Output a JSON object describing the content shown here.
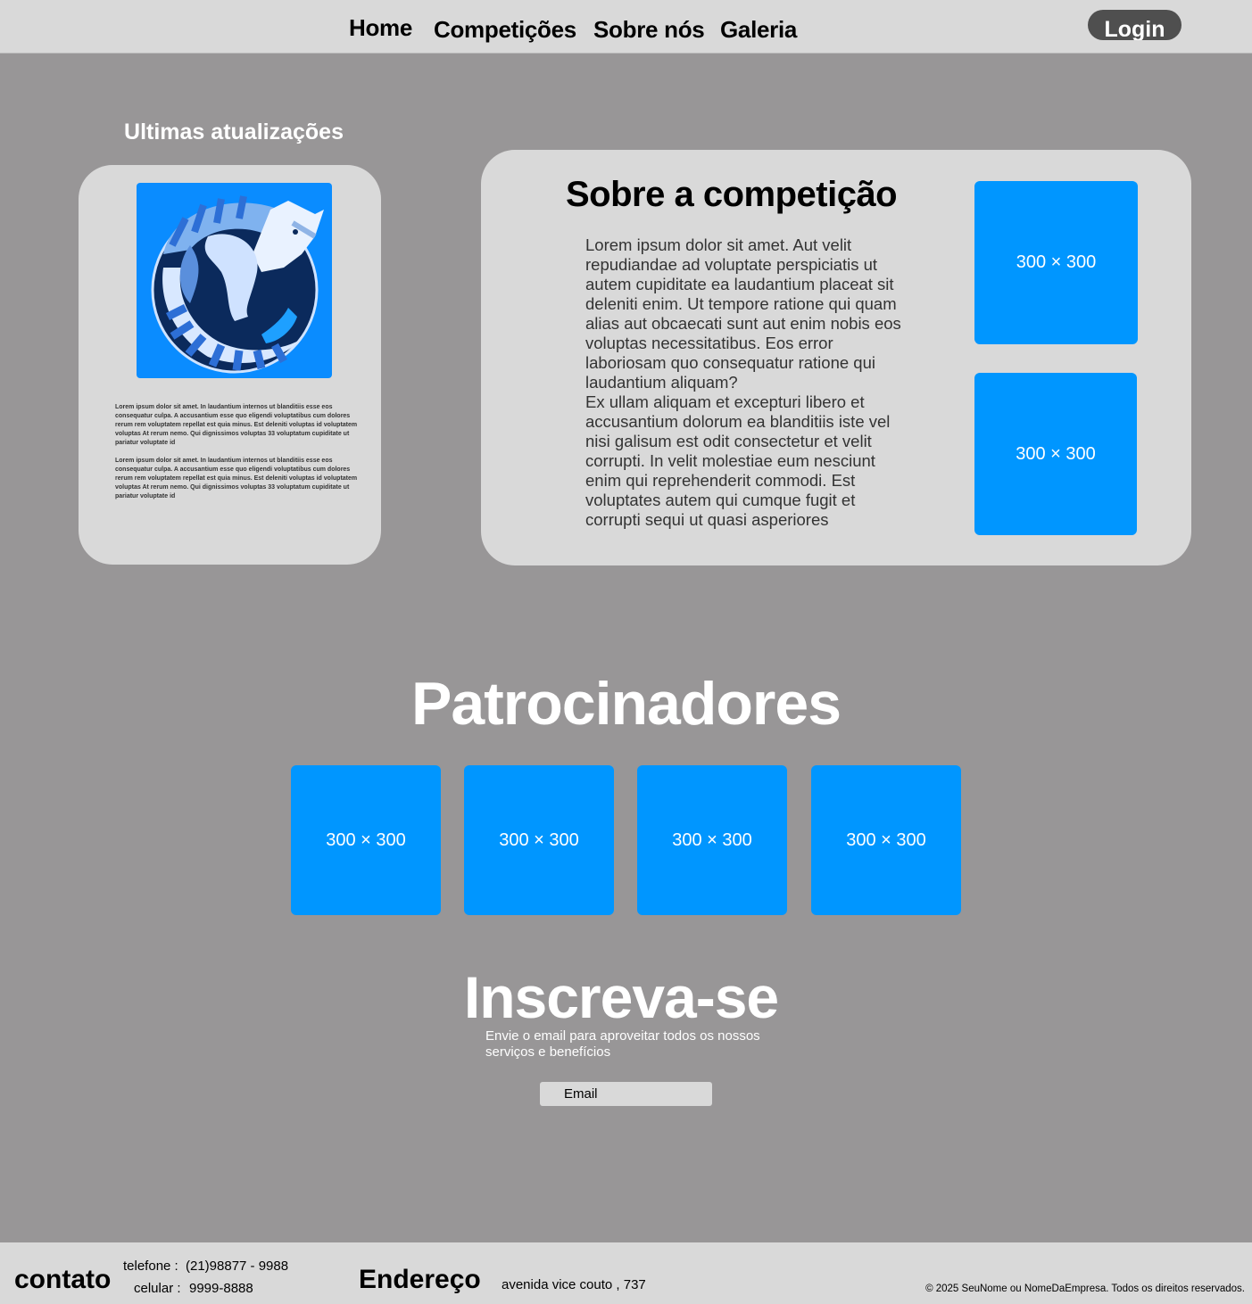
{
  "nav": {
    "home": "Home",
    "competicoes": "Competições",
    "sobre": "Sobre nós",
    "galeria": "Galeria",
    "login": "Login"
  },
  "updates": {
    "title": "Ultimas atualizações",
    "paragraphs": [
      "Lorem ipsum dolor sit amet. In laudantium internos ut blanditiis esse eos consequatur culpa. A accusantium esse quo eligendi voluptatibus cum dolores rerum rem voluptatem repellat est quia minus. Est deleniti voluptas id voluptatem voluptas At rerum nemo. Qui dignissimos voluptas 33 voluptatum cupiditate ut pariatur voluptate id",
      "Lorem ipsum dolor sit amet. In laudantium internos ut blanditiis esse eos consequatur culpa. A accusantium esse quo eligendi voluptatibus cum dolores rerum rem voluptatem repellat est quia minus. Est deleniti voluptas id voluptatem voluptas At rerum nemo. Qui dignissimos voluptas 33 voluptatum cupiditate ut pariatur voluptate id"
    ]
  },
  "about": {
    "title": "Sobre a competição",
    "paragraphs": [
      "Lorem ipsum dolor sit amet. Aut velit repudiandae ad voluptate perspiciatis ut autem cupiditate ea laudantium placeat sit deleniti enim. Ut tempore ratione qui quam alias aut obcaecati sunt aut enim nobis eos voluptas necessitatibus. Eos error laboriosam quo consequatur ratione qui laudantium aliquam?",
      "Ex ullam aliquam et excepturi libero et accusantium dolorum ea blanditiis iste vel nisi galisum est odit consectetur et velit corrupti. In velit molestiae eum nesciunt enim qui reprehenderit commodi. Est voluptates autem qui cumque fugit et corrupti sequi ut quasi asperiores"
    ],
    "image_labels": [
      "300 × 300",
      "300 × 300"
    ]
  },
  "sponsors": {
    "title": "Patrocinadores",
    "logos": [
      "300 × 300",
      "300 × 300",
      "300 × 300",
      "300 × 300"
    ]
  },
  "subscribe": {
    "title": "Inscreva-se",
    "description": "Envie o email para aproveitar todos os nossos serviços e benefícios",
    "email_placeholder": "Email"
  },
  "footer": {
    "contact_title": "contato",
    "phone_label": "telefone :",
    "phone_value": "(21)98877 - 9988",
    "cell_label": "celular :",
    "cell_value": "9999-8888",
    "address_title": "Endereço",
    "address_value": "avenida vice couto , 737",
    "copyright": "© 2025 SeuNome ou NomeDaEmpresa. Todos os direitos reservados."
  },
  "colors": {
    "background": "#989697",
    "panel": "#d9d9d9",
    "placeholder_blue": "#0096ff",
    "login_button": "#4f4f4f"
  },
  "icons": {
    "updates_image": "sleeping-cat-illustration"
  }
}
